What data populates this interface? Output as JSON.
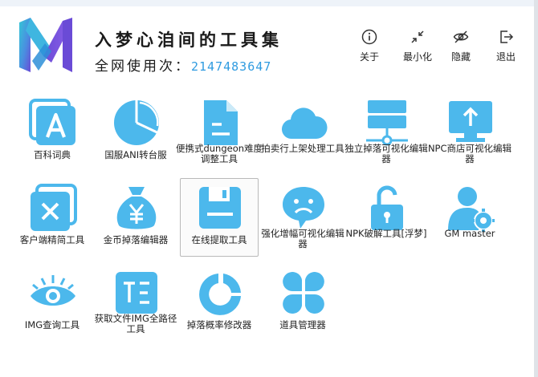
{
  "app": {
    "title": "入梦心洎间的工具集",
    "usage_label": "全网使用次：",
    "usage_count": "2147483647"
  },
  "colors": {
    "accent": "#4cb8ec",
    "count": "#2f9be0",
    "logo_purple": "#6a4bd6",
    "logo_teal": "#34c7d6"
  },
  "header_buttons": [
    {
      "label": "关于",
      "icon": "info-icon"
    },
    {
      "label": "最小化",
      "icon": "minimize-icon"
    },
    {
      "label": "隐藏",
      "icon": "eye-off-icon"
    },
    {
      "label": "退出",
      "icon": "exit-icon"
    }
  ],
  "tools": [
    {
      "label": "百科词典",
      "icon": "dictionary-icon"
    },
    {
      "label": "国服ANI转台服",
      "icon": "pie-chart-icon"
    },
    {
      "label": "便携式dungeon难度调整工具",
      "icon": "document-icon"
    },
    {
      "label": "拍卖行上架处理工具",
      "icon": "cloud-icon"
    },
    {
      "label": "独立掉落可视化编辑器",
      "icon": "server-icon"
    },
    {
      "label": "NPC商店可视化编辑器",
      "icon": "monitor-upload-icon"
    },
    {
      "label": "客户端精简工具",
      "icon": "close-box-icon"
    },
    {
      "label": "金币掉落编辑器",
      "icon": "money-bag-icon"
    },
    {
      "label": "在线提取工具",
      "icon": "save-icon",
      "selected": true
    },
    {
      "label": "强化增幅可视化编辑器",
      "icon": "sad-face-icon"
    },
    {
      "label": "NPK破解工具[浮梦]",
      "icon": "unlock-icon"
    },
    {
      "label": "GM master",
      "icon": "user-settings-icon"
    },
    {
      "label": "IMG查询工具",
      "icon": "eye-icon"
    },
    {
      "label": "获取文件IMG全路径工具",
      "icon": "text-icon"
    },
    {
      "label": "掉落概率修改器",
      "icon": "ring-chart-icon"
    },
    {
      "label": "道具管理器",
      "icon": "clover-icon"
    }
  ]
}
